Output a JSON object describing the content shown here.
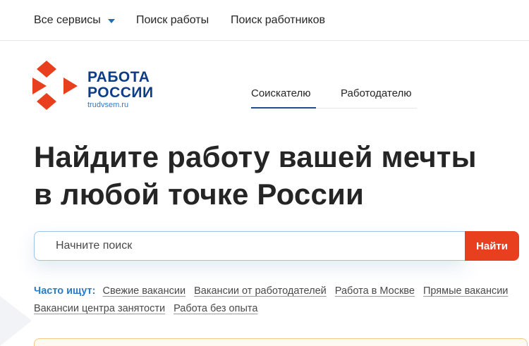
{
  "topnav": {
    "services_label": "Все сервисы",
    "job_search_label": "Поиск работы",
    "worker_search_label": "Поиск работников"
  },
  "logo": {
    "line1": "РАБОТА",
    "line2": "РОССИИ",
    "domain": "trudvsem.ru"
  },
  "role_tabs": [
    {
      "label": "Соискателю",
      "active": true
    },
    {
      "label": "Работодателю",
      "active": false
    }
  ],
  "hero": {
    "line1": "Найдите работу вашей мечты",
    "line2": "в любой точке России"
  },
  "search": {
    "placeholder": "Начните поиск",
    "button_label": "Найти"
  },
  "popular": {
    "label": "Часто ищут:",
    "links": [
      "Свежие вакансии",
      "Вакансии от работодателей",
      "Работа в Москве",
      "Прямые вакансии",
      "Вакансии центра занятости",
      "Работа без опыта"
    ]
  },
  "colors": {
    "brand_blue": "#0d3d86",
    "accent_orange": "#e8401f",
    "link_blue": "#2e7bc2"
  }
}
